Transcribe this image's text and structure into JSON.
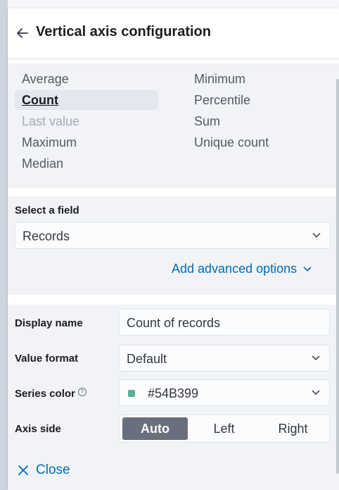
{
  "header": {
    "title": "Vertical axis configuration",
    "back_icon": "arrow-left-icon"
  },
  "operations": {
    "left": [
      {
        "label": "Average",
        "state": "normal"
      },
      {
        "label": "Count",
        "state": "selected"
      },
      {
        "label": "Last value",
        "state": "disabled"
      },
      {
        "label": "Maximum",
        "state": "normal"
      },
      {
        "label": "Median",
        "state": "normal"
      }
    ],
    "right": [
      {
        "label": "Minimum",
        "state": "normal"
      },
      {
        "label": "Percentile",
        "state": "normal"
      },
      {
        "label": "Sum",
        "state": "normal"
      },
      {
        "label": "Unique count",
        "state": "normal"
      }
    ]
  },
  "field": {
    "label": "Select a field",
    "value": "Records",
    "advanced_label": "Add advanced options"
  },
  "form": {
    "display_name": {
      "label": "Display name",
      "value": "Count of records"
    },
    "value_format": {
      "label": "Value format",
      "value": "Default"
    },
    "series_color": {
      "label": "Series color",
      "help": "?",
      "value": "#54B399",
      "swatch": "#54B399"
    },
    "axis_side": {
      "label": "Axis side",
      "options": [
        "Auto",
        "Left",
        "Right"
      ],
      "selected": "Auto"
    }
  },
  "footer": {
    "close_label": "Close"
  },
  "colors": {
    "accent": "#006bb8",
    "selected_bg": "#69707d"
  }
}
